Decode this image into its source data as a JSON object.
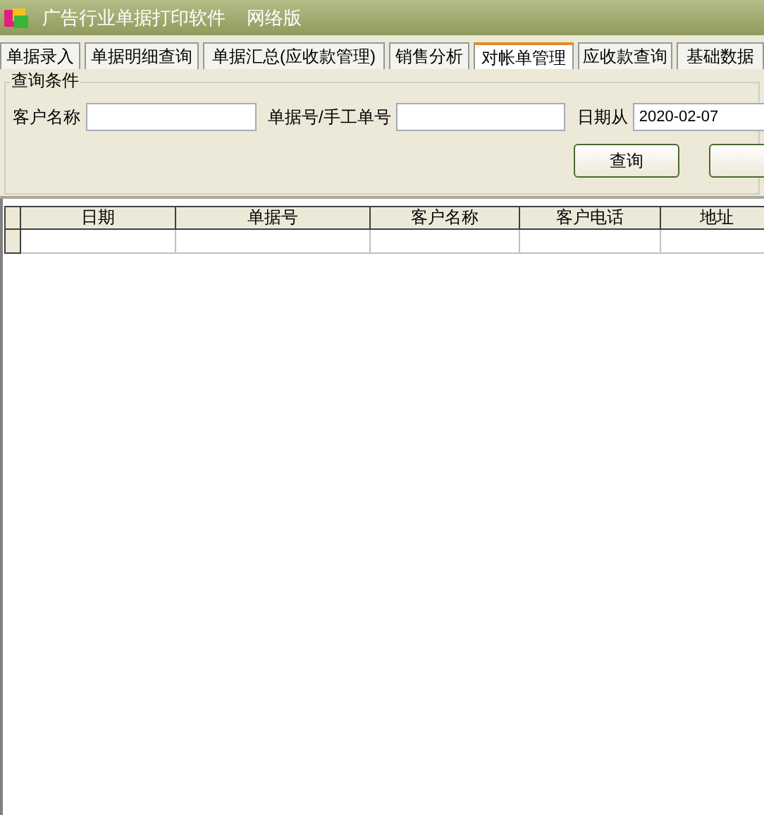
{
  "window": {
    "title": "广告行业单据打印软件",
    "edition": "网络版"
  },
  "tabs": [
    {
      "label": "单据录入",
      "selected": false
    },
    {
      "label": "单据明细查询",
      "selected": false
    },
    {
      "label": "单据汇总(应收款管理)",
      "selected": false
    },
    {
      "label": "销售分析",
      "selected": false
    },
    {
      "label": "对帐单管理",
      "selected": true
    },
    {
      "label": "应收款查询",
      "selected": false
    },
    {
      "label": "基础数据",
      "selected": false
    }
  ],
  "query": {
    "title": "查询条件",
    "fields": [
      {
        "label": "客户名称"
      },
      {
        "label": "单据号/手工单号"
      },
      {
        "label": "日期从",
        "value": "2020-02-07"
      }
    ],
    "buttons": [
      "查询"
    ]
  },
  "table": {
    "columns": [
      "日期",
      "单据号",
      "客户名称",
      "客户电话",
      "地址"
    ]
  }
}
